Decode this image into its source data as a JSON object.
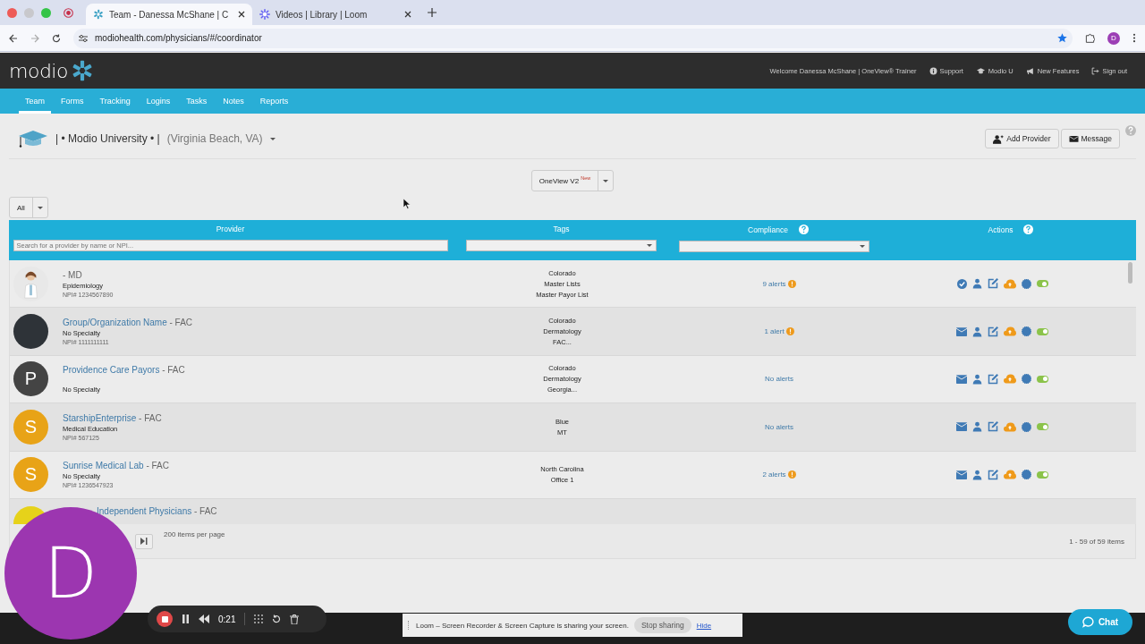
{
  "browser": {
    "tabs": [
      {
        "title": "Team - Danessa McShane | C",
        "kind": "modio",
        "selected": true
      },
      {
        "title": "Videos | Library | Loom",
        "kind": "loom",
        "selected": false
      }
    ],
    "url": "modiohealth.com/physicians/#/coordinator",
    "profile": "D"
  },
  "header": {
    "logo": "modio",
    "links": [
      {
        "label": "Welcome Danessa McShane | OneView® Trainer",
        "kind": "text"
      },
      {
        "label": "Support",
        "kind": "info"
      },
      {
        "label": "Modio U",
        "kind": "cap"
      },
      {
        "label": "New Features",
        "kind": "bullhorn"
      },
      {
        "label": "Sign out",
        "kind": "signout"
      }
    ]
  },
  "nav": [
    {
      "label": "Team",
      "selected": true
    },
    {
      "label": "Forms",
      "selected": false
    },
    {
      "label": "Tracking",
      "selected": false
    },
    {
      "label": "Logins",
      "selected": false
    },
    {
      "label": "Tasks",
      "selected": false
    },
    {
      "label": "Notes",
      "selected": false
    },
    {
      "label": "Reports",
      "selected": false
    }
  ],
  "org": {
    "name": "| • Modio University • |",
    "location": "(Virginia Beach, VA)"
  },
  "buttons": [
    {
      "label": "Add Provider",
      "kind": "add-user"
    },
    {
      "label": "Message",
      "kind": "envelope"
    }
  ],
  "view_switch": {
    "label": "OneView V2",
    "badge": "New"
  },
  "filter": {
    "label": "All"
  },
  "table": {
    "columns": [
      {
        "label": "Provider",
        "help": false
      },
      {
        "label": "Tags",
        "help": false
      },
      {
        "label": "Compliance",
        "help": true
      },
      {
        "label": "Actions",
        "help": true
      }
    ],
    "search": {
      "placeholder": "Search for a provider by name or NPI..."
    },
    "rows": [
      {
        "name": "- MD",
        "specialty": "Epidemiology",
        "npi": "NPI# 1234567890",
        "avatar": {
          "kind": "photo"
        },
        "tags": [
          "Colorado",
          "Master Lists",
          "Master Payor List"
        ],
        "compliance": "9 alerts",
        "alert": true,
        "verified": true,
        "active": true
      },
      {
        "name": "Group/Organization Name",
        "suffix": "- FAC",
        "specialty": "No Specialty",
        "npi": "NPI# 1111111111",
        "avatar": {
          "kind": "blank",
          "color": "#2e3338"
        },
        "tags": [
          "Colorado",
          "Dermatology",
          "FAC..."
        ],
        "compliance": "1 alert",
        "alert": true,
        "verified": false,
        "active": true
      },
      {
        "name": "Providence Care Payors",
        "suffix": "- FAC",
        "specialty": "No Specialty",
        "avatar": {
          "kind": "letter",
          "letter": "P",
          "color": "#444444"
        },
        "tags": [
          "Colorado",
          "Dermatology",
          "Georgia..."
        ],
        "compliance": "No alerts",
        "alert": false,
        "verified": false,
        "active": true
      },
      {
        "name": "StarshipEnterprise",
        "suffix": "- FAC",
        "specialty": "Medical Education",
        "npi": "NPI# 567125",
        "avatar": {
          "kind": "letter",
          "letter": "S",
          "color": "#e8a317"
        },
        "tags": [
          "Blue",
          "MT"
        ],
        "compliance": "No alerts",
        "alert": false,
        "verified": false,
        "active": true
      },
      {
        "name": "Sunrise Medical Lab",
        "suffix": "- FAC",
        "specialty": "No Specialty",
        "npi": "NPI# 1236547923",
        "avatar": {
          "kind": "letter",
          "letter": "S",
          "color": "#e8a317"
        },
        "tags": [
          "North Carolina",
          "Office 1"
        ],
        "compliance": "2 alerts",
        "alert": true,
        "verified": false,
        "active": true
      },
      {
        "name": "Independent Physicians",
        "suffix": "- FAC",
        "avatar": {
          "kind": "blank",
          "color": "#e6d21a"
        }
      }
    ]
  },
  "pager": {
    "per_page": "200 items per page",
    "range": "1 - 59 of 59 items"
  },
  "loom": {
    "avatar": "D",
    "timer": "0:21",
    "banner": "Loom – Screen Recorder & Screen Capture is sharing your screen.",
    "stop": "Stop sharing",
    "hide": "Hide"
  },
  "chat": {
    "label": "Chat"
  }
}
